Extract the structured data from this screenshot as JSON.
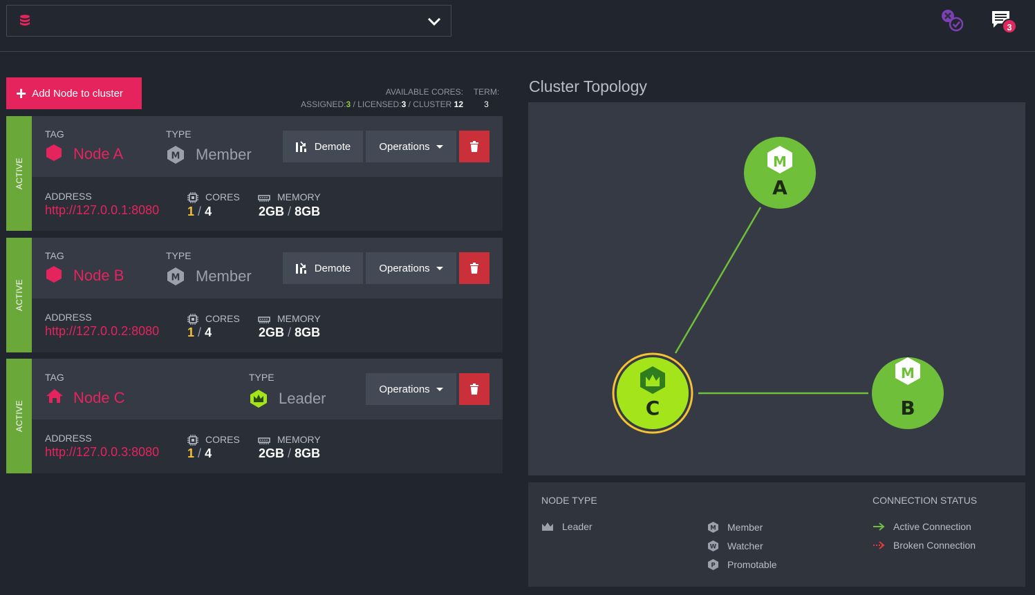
{
  "header": {
    "database_selector_value": "",
    "notification_count": "3"
  },
  "toolbar": {
    "add_node_label": "Add Node to cluster"
  },
  "cores_summary": {
    "available_label": "AVAILABLE CORES:",
    "assigned_label": "ASSIGNED:",
    "assigned_value": "3",
    "licensed_label": "LICENSED:",
    "licensed_value": "3",
    "cluster_label": "CLUSTER",
    "cluster_value": "12",
    "term_label": "TERM:",
    "term_value": "3"
  },
  "labels": {
    "active": "ACTIVE",
    "tag": "TAG",
    "type": "TYPE",
    "address": "ADDRESS",
    "cores": "CORES",
    "memory": "MEMORY",
    "demote": "Demote",
    "operations": "Operations",
    "separator": "/"
  },
  "nodes": [
    {
      "tag": "Node A",
      "type": "Member",
      "address": "http://127.0.0.1:8080",
      "cores_used": "1",
      "cores_total": "4",
      "mem_used": "2GB",
      "mem_total": "8GB"
    },
    {
      "tag": "Node B",
      "type": "Member",
      "address": "http://127.0.0.2:8080",
      "cores_used": "1",
      "cores_total": "4",
      "mem_used": "2GB",
      "mem_total": "8GB"
    },
    {
      "tag": "Node C",
      "type": "Leader",
      "address": "http://127.0.0.3:8080",
      "cores_used": "1",
      "cores_total": "4",
      "mem_used": "2GB",
      "mem_total": "8GB"
    }
  ],
  "topology": {
    "title": "Cluster Topology",
    "nodes": [
      {
        "letter": "A",
        "kind": "member"
      },
      {
        "letter": "B",
        "kind": "member"
      },
      {
        "letter": "C",
        "kind": "leader"
      }
    ],
    "connections": [
      {
        "from": "A",
        "to": "C",
        "status": "active"
      },
      {
        "from": "C",
        "to": "B",
        "status": "active"
      }
    ]
  },
  "legend": {
    "node_type_title": "NODE TYPE",
    "connection_status_title": "CONNECTION STATUS",
    "leader": "Leader",
    "member": "Member",
    "watcher": "Watcher",
    "promotable": "Promotable",
    "active_connection": "Active Connection",
    "broken_connection": "Broken Connection"
  },
  "colors": {
    "accent": "#e5245e",
    "active": "#6aa839",
    "node_green": "#6fbf3b",
    "leader_green": "#a3e41b",
    "leader_ring": "#f5c231",
    "danger": "#c9303a"
  }
}
